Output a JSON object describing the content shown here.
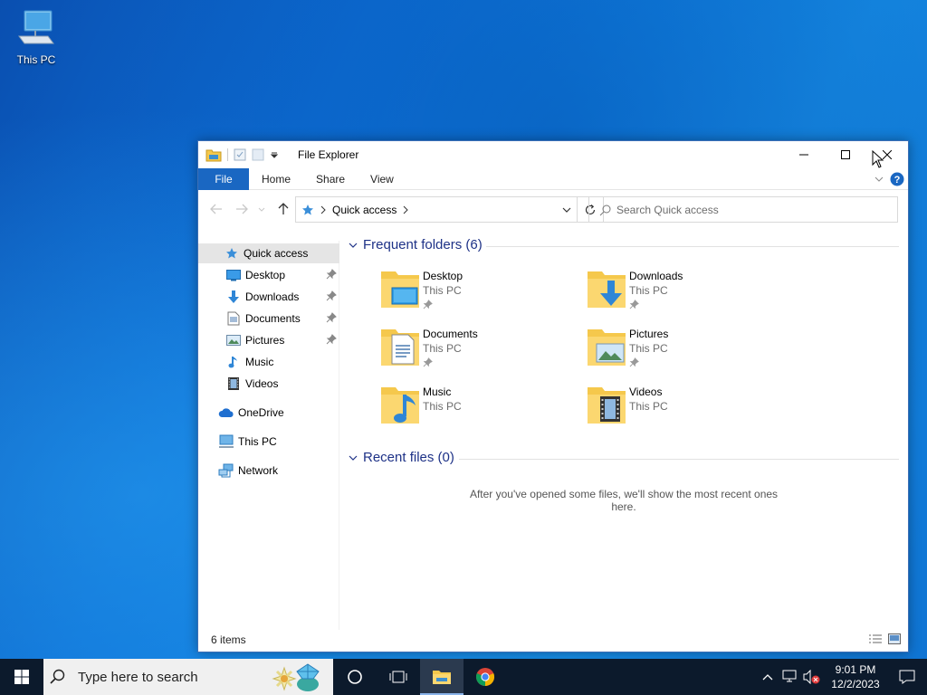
{
  "desktop": {
    "icons": [
      {
        "label": "This PC",
        "icon": "this-pc-icon"
      }
    ]
  },
  "window": {
    "title": "File Explorer",
    "ribbon_tabs": [
      "File",
      "Home",
      "Share",
      "View"
    ],
    "address": {
      "root": "Quick access"
    },
    "search_placeholder": "Search Quick access",
    "sidebar": {
      "quick_access": "Quick access",
      "pinned": [
        {
          "label": "Desktop",
          "icon": "desktop-icon",
          "pinned": true
        },
        {
          "label": "Downloads",
          "icon": "downloads-icon",
          "pinned": true
        },
        {
          "label": "Documents",
          "icon": "documents-icon",
          "pinned": true
        },
        {
          "label": "Pictures",
          "icon": "pictures-icon",
          "pinned": true
        },
        {
          "label": "Music",
          "icon": "music-icon",
          "pinned": false
        },
        {
          "label": "Videos",
          "icon": "videos-icon",
          "pinned": false
        }
      ],
      "onedrive": "OneDrive",
      "this_pc": "This PC",
      "network": "Network"
    },
    "frequent": {
      "heading": "Frequent folders (6)",
      "folders": [
        {
          "name": "Desktop",
          "location": "This PC",
          "pinned": true
        },
        {
          "name": "Downloads",
          "location": "This PC",
          "pinned": true
        },
        {
          "name": "Documents",
          "location": "This PC",
          "pinned": true
        },
        {
          "name": "Pictures",
          "location": "This PC",
          "pinned": true
        },
        {
          "name": "Music",
          "location": "This PC",
          "pinned": false
        },
        {
          "name": "Videos",
          "location": "This PC",
          "pinned": false
        }
      ]
    },
    "recent": {
      "heading": "Recent files (0)",
      "empty_message": "After you've opened some files, we'll show the most recent ones here."
    },
    "status": {
      "item_count": "6 items"
    }
  },
  "taskbar": {
    "search_placeholder": "Type here to search",
    "time": "9:01 PM",
    "date": "12/2/2023"
  },
  "colors": {
    "accent": "#1a67c2",
    "taskbar": "#0c1a2c",
    "folder": "#f5c84c",
    "heading": "#1e3287"
  }
}
